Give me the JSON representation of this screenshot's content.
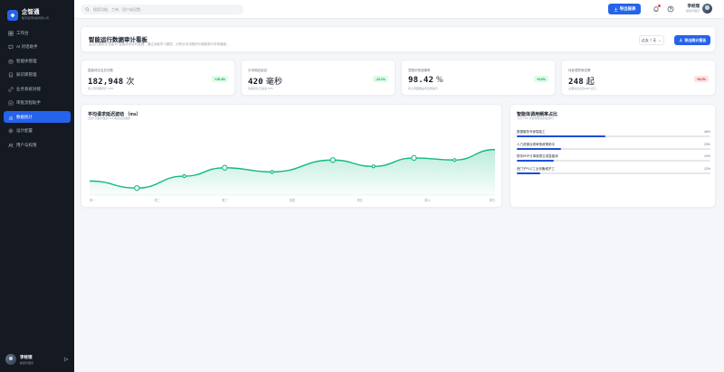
{
  "app": {
    "name": "企智通",
    "subtitle": "数字经济科技有限公司"
  },
  "sidebar": {
    "items": [
      {
        "label": "工作台",
        "icon": "grid-icon"
      },
      {
        "label": "AI 对话助手",
        "icon": "chat-icon"
      },
      {
        "label": "智能体管理",
        "icon": "bot-icon"
      },
      {
        "label": "知识库管理",
        "icon": "book-icon"
      },
      {
        "label": "业务系统对接",
        "icon": "link-icon"
      },
      {
        "label": "审批流程助手",
        "icon": "check-icon"
      },
      {
        "label": "数据统计",
        "icon": "chart-icon",
        "active": true
      },
      {
        "label": "设计配置",
        "icon": "settings-icon"
      },
      {
        "label": "用户与权限",
        "icon": "users-icon"
      }
    ],
    "user": {
      "name": "李经理",
      "role": "超级管理员"
    }
  },
  "topbar": {
    "search_placeholder": "搜索功能、工单、用户或设置...",
    "action_label": "导出报表",
    "user": {
      "name": "李经理",
      "role": "超级管理员"
    }
  },
  "header": {
    "title": "智能运行数据审计看板",
    "subtitle": "监控在途和企业级 AI 智能体的实时数据，通过深度学习模型，识别业务流程的长期趋势与异常偏差。",
    "range": "过去 7 天",
    "export_label": "导出统计报告"
  },
  "kpis": [
    {
      "label": "智能体交互总次数",
      "value": "182,948",
      "unit": "次",
      "change": "+18.4%",
      "direction": "up",
      "note": "较上周同期增长 2.8%"
    },
    {
      "label": "平均响应延迟",
      "value": "420",
      "unit": "毫秒",
      "change": "-12.1%",
      "direction": "up",
      "note": "性能优化已提速 15%"
    },
    {
      "label": "意图识别准确率",
      "value": "98.42",
      "unit": "%",
      "change": "+0.5%",
      "direction": "up",
      "note": "核心意图覆盖率显著提升"
    },
    {
      "label": "待处理异常告警",
      "value": "248",
      "unit": "起",
      "change": "+8.2%",
      "direction": "down",
      "note": "主要来自业务ERP 接口"
    }
  ],
  "chart_data": {
    "type": "area",
    "title": "平均请求延迟波动 （ms）",
    "subtitle": "过去7天各时段的 API 响应延迟趋势",
    "x": [
      "周一",
      "周二",
      "周三",
      "周四",
      "周五",
      "周六",
      "周日"
    ],
    "points": [
      {
        "x": 0.0,
        "y": 300
      },
      {
        "x": 0.7,
        "y": 250
      },
      {
        "x": 1.4,
        "y": 335
      },
      {
        "x": 2.0,
        "y": 395
      },
      {
        "x": 2.7,
        "y": 365
      },
      {
        "x": 3.6,
        "y": 450
      },
      {
        "x": 4.2,
        "y": 405
      },
      {
        "x": 4.8,
        "y": 465
      },
      {
        "x": 5.4,
        "y": 450
      },
      {
        "x": 6.0,
        "y": 525
      }
    ],
    "ylim": [
      200,
      600
    ],
    "color": "#10b981"
  },
  "ranking": {
    "title": "智能体调用频率占比",
    "subtitle": "今日 TOP 智能体使用热度排行",
    "items": [
      {
        "name": "数据服务专家智能工",
        "pct": "46%",
        "value": 46
      },
      {
        "name": "人力资源合规审核政策助手",
        "pct": "23%",
        "value": 23
      },
      {
        "name": "财务ERP订单报表生成智能体",
        "pct": "19%",
        "value": 19
      },
      {
        "name": "西门子PLC工业设备维护工",
        "pct": "12%",
        "value": 12
      }
    ]
  }
}
